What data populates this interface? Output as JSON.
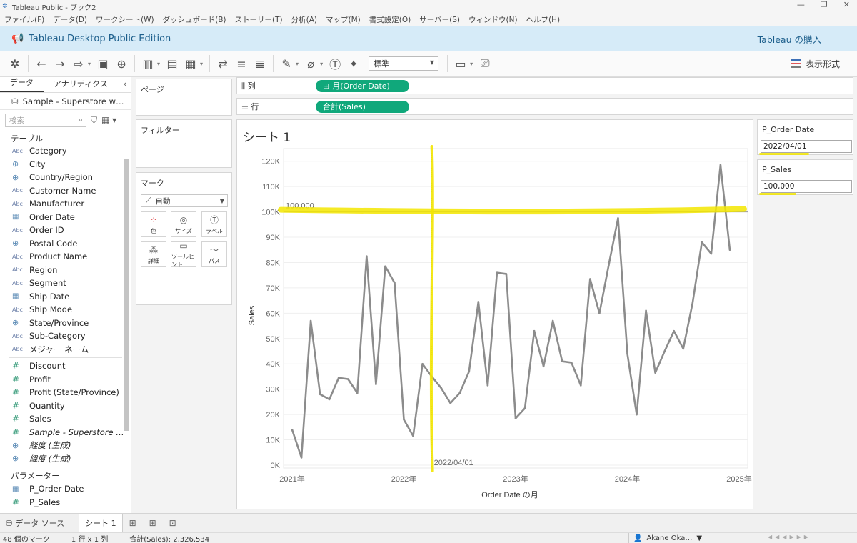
{
  "window": {
    "title": "Tableau Public - ブック2"
  },
  "menu": [
    "ファイル(F)",
    "データ(D)",
    "ワークシート(W)",
    "ダッシュボード(B)",
    "ストーリー(T)",
    "分析(A)",
    "マップ(M)",
    "書式設定(O)",
    "サーバー(S)",
    "ウィンドウ(N)",
    "ヘルプ(H)"
  ],
  "banner": {
    "title": "Tableau Desktop Public Edition",
    "buy": "Tableau の購入"
  },
  "toolbar": {
    "fit_value": "標準",
    "show_me": "表示形式"
  },
  "left_panel": {
    "tabs": [
      "データ",
      "アナリティクス"
    ],
    "datasource": "Sample - Superstore w…",
    "search_placeholder": "検索",
    "tables_label": "テーブル",
    "dimensions": [
      {
        "type": "Abc",
        "name": "Category"
      },
      {
        "type": "geo",
        "name": "City"
      },
      {
        "type": "geo",
        "name": "Country/Region"
      },
      {
        "type": "Abc",
        "name": "Customer Name"
      },
      {
        "type": "Abc",
        "name": "Manufacturer"
      },
      {
        "type": "date",
        "name": "Order Date"
      },
      {
        "type": "Abc",
        "name": "Order ID"
      },
      {
        "type": "geo",
        "name": "Postal Code"
      },
      {
        "type": "Abc",
        "name": "Product Name"
      },
      {
        "type": "Abc",
        "name": "Region"
      },
      {
        "type": "Abc",
        "name": "Segment"
      },
      {
        "type": "date",
        "name": "Ship Date"
      },
      {
        "type": "Abc",
        "name": "Ship Mode"
      },
      {
        "type": "geo",
        "name": "State/Province"
      },
      {
        "type": "Abc",
        "name": "Sub-Category"
      },
      {
        "type": "Abc",
        "name": "メジャー ネーム"
      }
    ],
    "measures": [
      {
        "type": "num",
        "name": "Discount"
      },
      {
        "type": "num",
        "name": "Profit"
      },
      {
        "type": "num",
        "name": "Profit (State/Province)"
      },
      {
        "type": "num",
        "name": "Quantity"
      },
      {
        "type": "num",
        "name": "Sales"
      },
      {
        "type": "num",
        "name": "Sample - Superstore …",
        "italic": true
      },
      {
        "type": "geo",
        "name": "経度 (生成)",
        "italic": true
      },
      {
        "type": "geo",
        "name": "緯度 (生成)",
        "italic": true
      }
    ],
    "params_label": "パラメーター",
    "parameters": [
      {
        "type": "date",
        "name": "P_Order Date"
      },
      {
        "type": "num",
        "name": "P_Sales"
      }
    ]
  },
  "cards": {
    "pages": "ページ",
    "filters": "フィルター",
    "marks": "マーク",
    "mark_type": "自動",
    "mark_buttons": [
      "色",
      "サイズ",
      "ラベル",
      "詳細",
      "ツールヒント",
      "パス"
    ]
  },
  "shelves": {
    "columns_label": "列",
    "columns_pill": "月(Order Date)",
    "rows_label": "行",
    "rows_pill": "合計(Sales)"
  },
  "sheet": {
    "title": "シート 1"
  },
  "chart_data": {
    "type": "line",
    "xlabel": "Order Date の月",
    "ylabel": "Sales",
    "x_tick_labels": [
      "2021年",
      "2022年",
      "2023年",
      "2024年",
      "2025年"
    ],
    "y_tick_labels": [
      "0K",
      "10K",
      "20K",
      "30K",
      "40K",
      "50K",
      "60K",
      "70K",
      "80K",
      "90K",
      "100K",
      "110K",
      "120K"
    ],
    "ylim": [
      0,
      125000
    ],
    "x_range_years": [
      2021.0,
      2025.0
    ],
    "grid": true,
    "line_color": "#8c8c8c",
    "months": [
      "2021-01",
      "2021-02",
      "2021-03",
      "2021-04",
      "2021-05",
      "2021-06",
      "2021-07",
      "2021-08",
      "2021-09",
      "2021-10",
      "2021-11",
      "2021-12",
      "2022-01",
      "2022-02",
      "2022-03",
      "2022-04",
      "2022-05",
      "2022-06",
      "2022-07",
      "2022-08",
      "2022-09",
      "2022-10",
      "2022-11",
      "2022-12",
      "2023-01",
      "2023-02",
      "2023-03",
      "2023-04",
      "2023-05",
      "2023-06",
      "2023-07",
      "2023-08",
      "2023-09",
      "2023-10",
      "2023-11",
      "2023-12",
      "2024-01",
      "2024-02",
      "2024-03",
      "2024-04",
      "2024-05",
      "2024-06",
      "2024-07",
      "2024-08",
      "2024-09",
      "2024-10",
      "2024-11",
      "2024-12"
    ],
    "values": [
      14000,
      3000,
      57000,
      28000,
      26000,
      34500,
      34000,
      28500,
      82500,
      32000,
      78500,
      72000,
      18000,
      11500,
      40000,
      35000,
      30500,
      24500,
      28500,
      37000,
      64500,
      31500,
      76000,
      75500,
      18500,
      22500,
      53000,
      39000,
      57000,
      41000,
      40500,
      31500,
      73500,
      60000,
      79000,
      97500,
      44000,
      20000,
      61000,
      36500,
      45000,
      53000,
      46000,
      64000,
      88000,
      83500,
      118500,
      85000
    ],
    "reference_lines": [
      {
        "axis": "y",
        "value": 100000,
        "label": "100,000"
      },
      {
        "axis": "x",
        "value": "2022-04-01",
        "label": "2022/04/01"
      }
    ],
    "highlight_color": "#f3e600"
  },
  "parameters_cards": [
    {
      "title": "P_Order Date",
      "value": "2022/04/01"
    },
    {
      "title": "P_Sales",
      "value": "100,000"
    }
  ],
  "tabs_bar": {
    "datasource": "データ ソース",
    "sheet": "シート 1"
  },
  "status": {
    "marks": "48 個のマーク",
    "rows_cols": "1 行 x 1 列",
    "sum": "合計(Sales): 2,326,534",
    "user": "Akane Oka…"
  }
}
